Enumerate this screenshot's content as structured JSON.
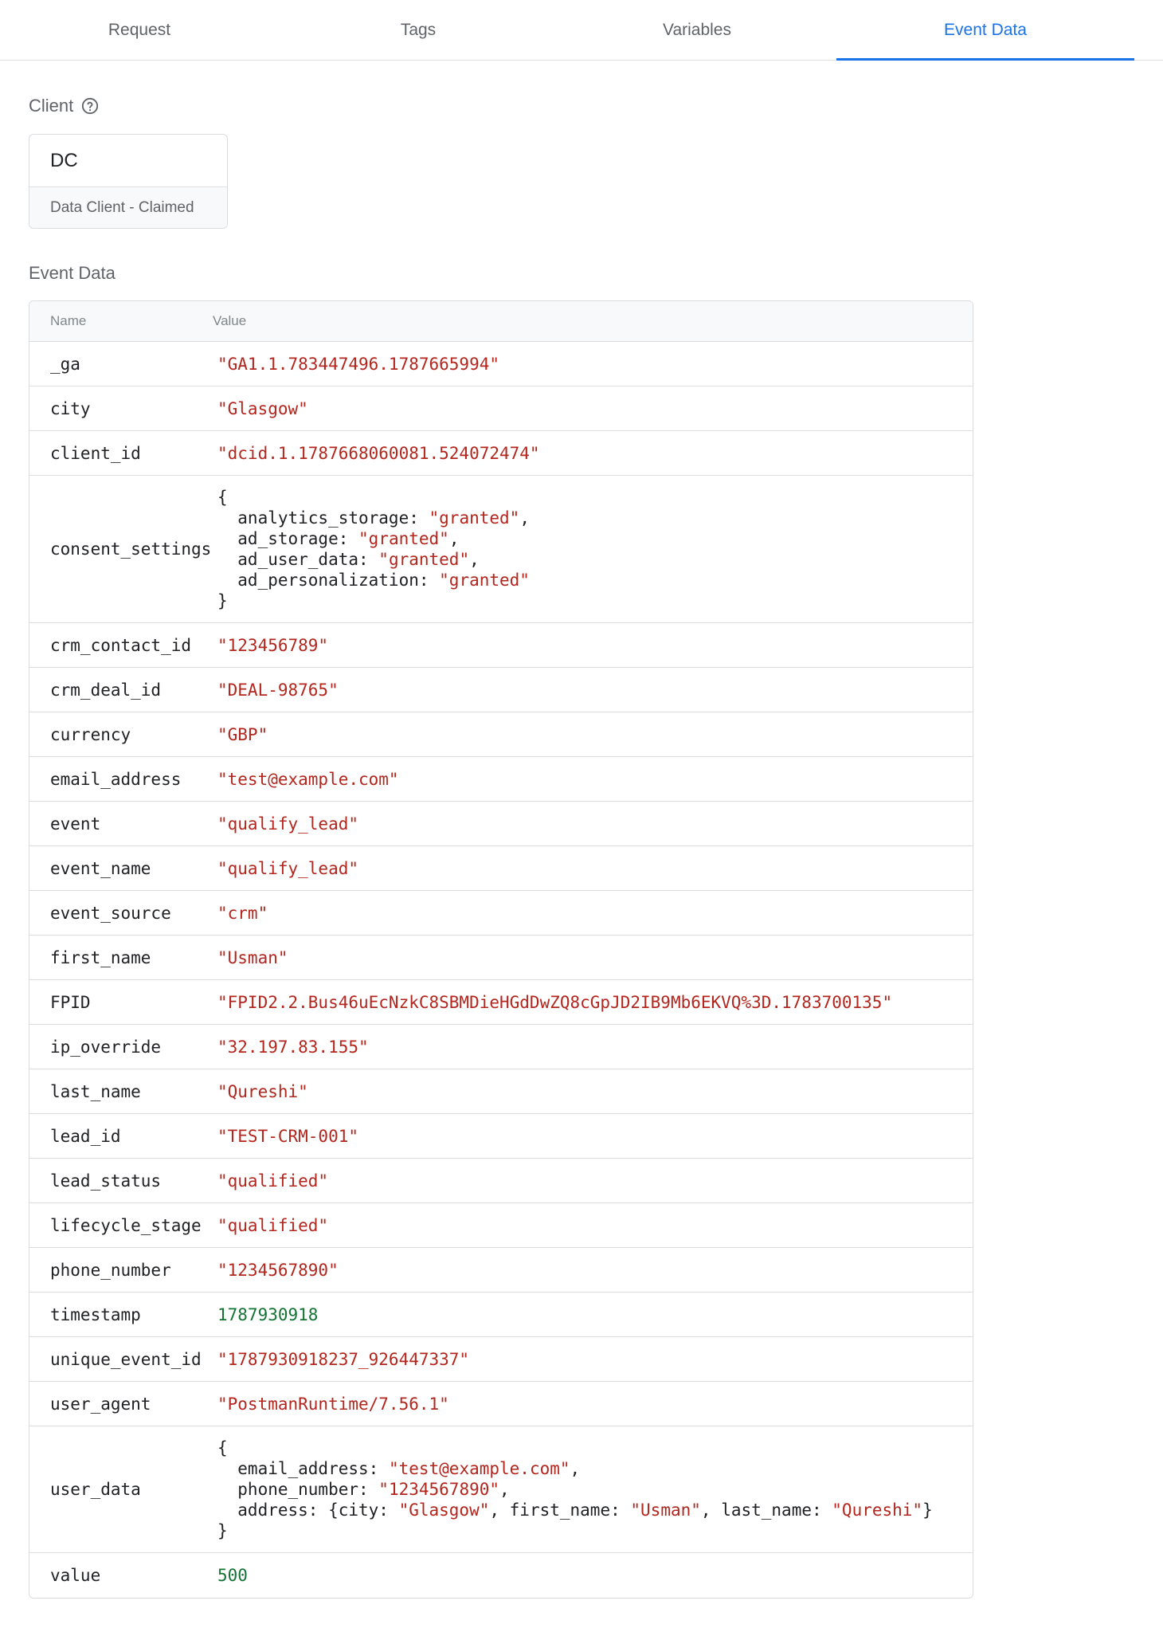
{
  "tabs": [
    {
      "label": "Request",
      "active": false
    },
    {
      "label": "Tags",
      "active": false
    },
    {
      "label": "Variables",
      "active": false
    },
    {
      "label": "Event Data",
      "active": true
    }
  ],
  "client": {
    "section_label": "Client",
    "name": "DC",
    "status": "Data Client - Claimed"
  },
  "event_data": {
    "section_label": "Event Data",
    "columns": {
      "name": "Name",
      "value": "Value"
    },
    "rows": [
      {
        "name": "_ga",
        "value": "\"GA1.1.783447496.1787665994\"",
        "kind": "string"
      },
      {
        "name": "city",
        "value": "\"Glasgow\"",
        "kind": "string"
      },
      {
        "name": "client_id",
        "value": "\"dcid.1.1787668060081.524072474\"",
        "kind": "string"
      },
      {
        "name": "consent_settings",
        "kind": "object",
        "lines": [
          [
            {
              "t": "{",
              "c": "plain"
            }
          ],
          [
            {
              "t": "  analytics_storage: ",
              "c": "plain"
            },
            {
              "t": "\"granted\"",
              "c": "str"
            },
            {
              "t": ",",
              "c": "plain"
            }
          ],
          [
            {
              "t": "  ad_storage: ",
              "c": "plain"
            },
            {
              "t": "\"granted\"",
              "c": "str"
            },
            {
              "t": ",",
              "c": "plain"
            }
          ],
          [
            {
              "t": "  ad_user_data: ",
              "c": "plain"
            },
            {
              "t": "\"granted\"",
              "c": "str"
            },
            {
              "t": ",",
              "c": "plain"
            }
          ],
          [
            {
              "t": "  ad_personalization: ",
              "c": "plain"
            },
            {
              "t": "\"granted\"",
              "c": "str"
            }
          ],
          [
            {
              "t": "}",
              "c": "plain"
            }
          ]
        ]
      },
      {
        "name": "crm_contact_id",
        "value": "\"123456789\"",
        "kind": "string"
      },
      {
        "name": "crm_deal_id",
        "value": "\"DEAL-98765\"",
        "kind": "string"
      },
      {
        "name": "currency",
        "value": "\"GBP\"",
        "kind": "string"
      },
      {
        "name": "email_address",
        "value": "\"test@example.com\"",
        "kind": "string"
      },
      {
        "name": "event",
        "value": "\"qualify_lead\"",
        "kind": "string"
      },
      {
        "name": "event_name",
        "value": "\"qualify_lead\"",
        "kind": "string"
      },
      {
        "name": "event_source",
        "value": "\"crm\"",
        "kind": "string"
      },
      {
        "name": "first_name",
        "value": "\"Usman\"",
        "kind": "string"
      },
      {
        "name": "FPID",
        "value": "\"FPID2.2.Bus46uEcNzkC8SBMDieHGdDwZQ8cGpJD2IB9Mb6EKVQ%3D.1783700135\"",
        "kind": "string"
      },
      {
        "name": "ip_override",
        "value": "\"32.197.83.155\"",
        "kind": "string"
      },
      {
        "name": "last_name",
        "value": "\"Qureshi\"",
        "kind": "string"
      },
      {
        "name": "lead_id",
        "value": "\"TEST-CRM-001\"",
        "kind": "string"
      },
      {
        "name": "lead_status",
        "value": "\"qualified\"",
        "kind": "string"
      },
      {
        "name": "lifecycle_stage",
        "value": "\"qualified\"",
        "kind": "string"
      },
      {
        "name": "phone_number",
        "value": "\"1234567890\"",
        "kind": "string"
      },
      {
        "name": "timestamp",
        "value": "1787930918",
        "kind": "number"
      },
      {
        "name": "unique_event_id",
        "value": "\"1787930918237_926447337\"",
        "kind": "string"
      },
      {
        "name": "user_agent",
        "value": "\"PostmanRuntime/7.56.1\"",
        "kind": "string"
      },
      {
        "name": "user_data",
        "kind": "object",
        "lines": [
          [
            {
              "t": "{",
              "c": "plain"
            }
          ],
          [
            {
              "t": "  email_address: ",
              "c": "plain"
            },
            {
              "t": "\"test@example.com\"",
              "c": "str"
            },
            {
              "t": ",",
              "c": "plain"
            }
          ],
          [
            {
              "t": "  phone_number: ",
              "c": "plain"
            },
            {
              "t": "\"1234567890\"",
              "c": "str"
            },
            {
              "t": ",",
              "c": "plain"
            }
          ],
          [
            {
              "t": "  address: {city: ",
              "c": "plain"
            },
            {
              "t": "\"Glasgow\"",
              "c": "str"
            },
            {
              "t": ", first_name: ",
              "c": "plain"
            },
            {
              "t": "\"Usman\"",
              "c": "str"
            },
            {
              "t": ", last_name: ",
              "c": "plain"
            },
            {
              "t": "\"Qureshi\"",
              "c": "str"
            },
            {
              "t": "}",
              "c": "plain"
            }
          ],
          [
            {
              "t": "}",
              "c": "plain"
            }
          ]
        ]
      },
      {
        "name": "value",
        "value": "500",
        "kind": "number"
      }
    ]
  },
  "colors": {
    "accent": "#1a73e8",
    "string": "#b3261e",
    "number": "#137333"
  },
  "icons": {
    "help": "help-circle-icon"
  }
}
